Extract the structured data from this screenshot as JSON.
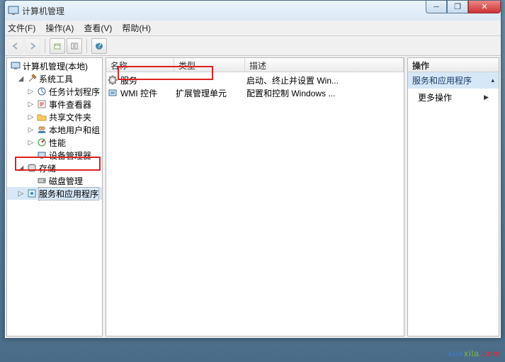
{
  "window": {
    "title": "计算机管理"
  },
  "menu": {
    "file": "文件(F)",
    "action": "操作(A)",
    "view": "查看(V)",
    "help": "帮助(H)"
  },
  "tree": {
    "root": "计算机管理(本地)",
    "system_tools": "系统工具",
    "task_scheduler": "任务计划程序",
    "event_viewer": "事件查看器",
    "shared_folders": "共享文件夹",
    "local_users": "本地用户和组",
    "performance": "性能",
    "device_manager": "设备管理器",
    "storage": "存储",
    "disk_management": "磁盘管理",
    "services_apps": "服务和应用程序"
  },
  "columns": {
    "name": "名称",
    "type": "类型",
    "desc": "描述"
  },
  "rows": [
    {
      "name": "服务",
      "type": "",
      "desc": "启动、终止并设置 Win..."
    },
    {
      "name": "WMI 控件",
      "type": "扩展管理单元",
      "desc": "配置和控制 Windows ..."
    }
  ],
  "actions": {
    "header": "操作",
    "section": "服务和应用程序",
    "more": "更多操作"
  },
  "watermark": {
    "a": "xue",
    "b": "xila",
    "c": ".com"
  }
}
